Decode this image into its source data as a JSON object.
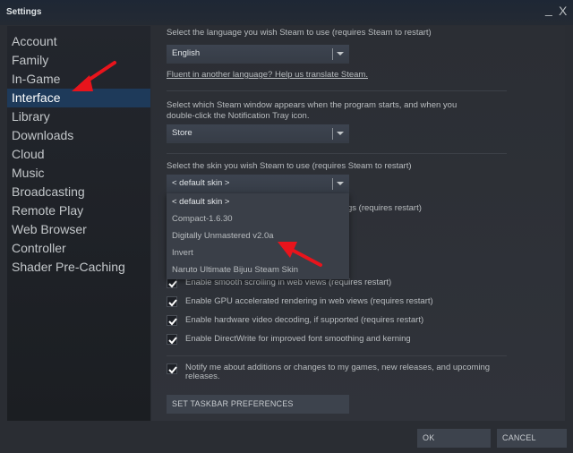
{
  "window": {
    "title": "Settings",
    "minimize_glyph": "_",
    "close_glyph": "X"
  },
  "sidebar": {
    "items": [
      {
        "label": "Account"
      },
      {
        "label": "Family"
      },
      {
        "label": "In-Game"
      },
      {
        "label": "Interface",
        "active": true
      },
      {
        "label": "Library"
      },
      {
        "label": "Downloads"
      },
      {
        "label": "Cloud"
      },
      {
        "label": "Music"
      },
      {
        "label": "Broadcasting"
      },
      {
        "label": "Remote Play"
      },
      {
        "label": "Web Browser"
      },
      {
        "label": "Controller"
      },
      {
        "label": "Shader Pre-Caching"
      }
    ]
  },
  "language": {
    "label": "Select the language you wish Steam to use (requires Steam to restart)",
    "value": "English",
    "translate_link": "Fluent in another language? Help us translate Steam."
  },
  "start_window": {
    "label_line1": "Select which Steam window appears when the program starts, and when you",
    "label_line2": "double-click the Notification Tray icon.",
    "value": "Store"
  },
  "skin": {
    "label": "Select the skin you wish Steam to use (requires Steam to restart)",
    "value": "< default skin >",
    "options": [
      "< default skin >",
      "Compact-1.6.30",
      "Digitally Unmastered v2.0a",
      "Invert",
      "Naruto Ultimate Bijuu Steam Skin"
    ],
    "obscured_option_fragment": "gs (requires restart)"
  },
  "checkboxes": [
    {
      "label": "Enable smooth scrolling in web views (requires restart)",
      "checked": true
    },
    {
      "label": "Enable GPU accelerated rendering in web views (requires restart)",
      "checked": true
    },
    {
      "label": "Enable hardware video decoding, if supported (requires restart)",
      "checked": true
    },
    {
      "label": "Enable DirectWrite for improved font smoothing and kerning",
      "checked": true
    }
  ],
  "notify": {
    "label_line1": "Notify me about additions or changes to my games, new releases, and upcoming",
    "label_line2": "releases.",
    "checked": true
  },
  "buttons": {
    "taskbar": "SET TASKBAR PREFERENCES",
    "ok": "OK",
    "cancel": "CANCEL"
  },
  "annotation_color": "#e8141c"
}
